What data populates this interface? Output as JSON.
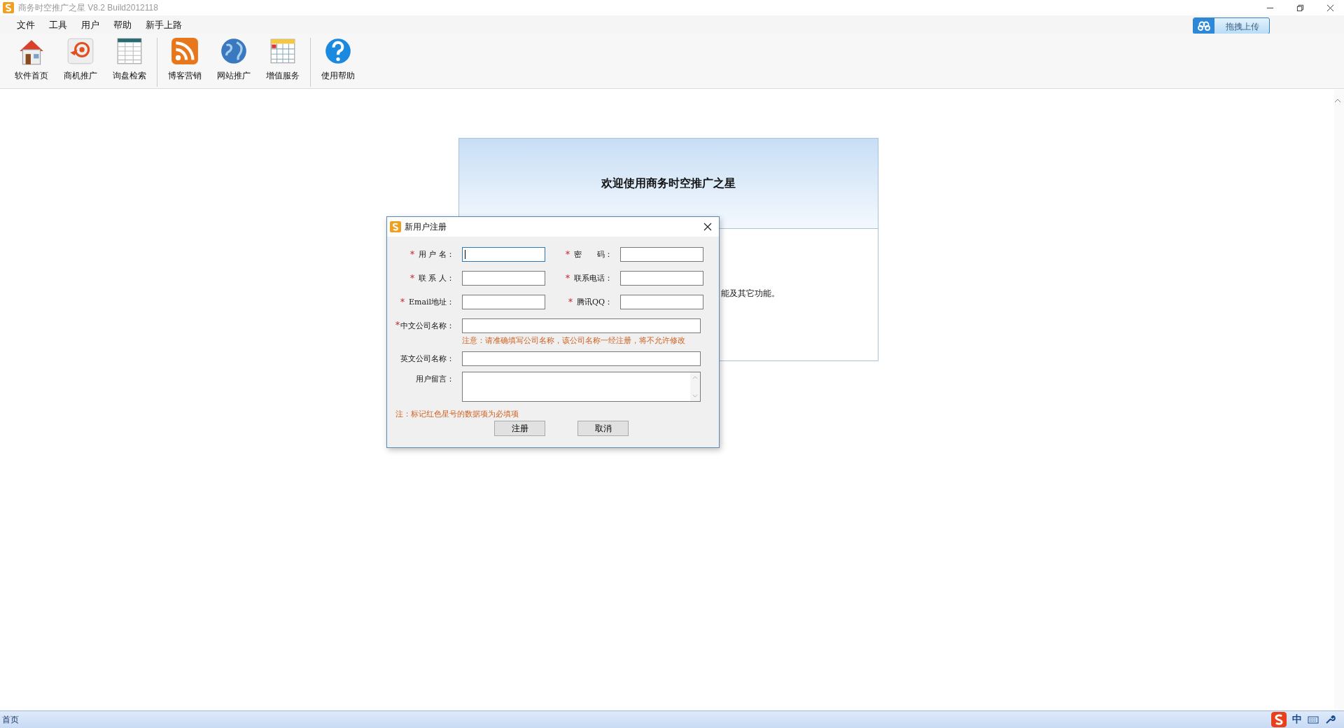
{
  "window": {
    "title": "商务时空推广之星 V8.2 Build2012118",
    "upload_button": "拖拽上传"
  },
  "menu": [
    "文件",
    "工具",
    "用户",
    "帮助",
    "新手上路"
  ],
  "toolbar_groups": [
    [
      {
        "label": "软件首页",
        "kind": "house"
      },
      {
        "label": "商机推广",
        "kind": "target"
      },
      {
        "label": "询盘检索",
        "kind": "table"
      }
    ],
    [
      {
        "label": "博客营销",
        "kind": "rss"
      },
      {
        "label": "网站推广",
        "kind": "globe"
      },
      {
        "label": "增值服务",
        "kind": "calendar"
      }
    ],
    [
      {
        "label": "使用帮助",
        "kind": "help"
      }
    ]
  ],
  "welcome": {
    "title": "欢迎使用商务时空推广之星",
    "body": "能及其它功能。"
  },
  "dialog": {
    "title": "新用户注册",
    "pairs": [
      [
        {
          "label": "用 户 名：",
          "marker": "*",
          "focused": true
        },
        {
          "label": "密　　码：",
          "marker": "*",
          "focused": false
        }
      ],
      [
        {
          "label": "联 系 人：",
          "marker": "*",
          "focused": false
        },
        {
          "label": "联系电话：",
          "marker": "*",
          "focused": false
        }
      ],
      [
        {
          "label": "Email地址：",
          "marker": "*",
          "focused": false
        },
        {
          "label": "腾讯QQ：",
          "marker": "*",
          "focused": false
        }
      ]
    ],
    "wide_fields": [
      {
        "label": "中文公司名称：",
        "marker": "*",
        "kind": "input",
        "hint": "注意：请准确填写公司名称，该公司名称一经注册，将不允许修改"
      },
      {
        "label": "英文公司名称：",
        "kind": "input"
      },
      {
        "label": "用户留言：",
        "kind": "textarea"
      }
    ],
    "note": "注：标记红色星号的数据项为必填项",
    "buttons": [
      "注册",
      "取消"
    ]
  },
  "status_bar": {
    "text": "首页",
    "ime": "中"
  }
}
